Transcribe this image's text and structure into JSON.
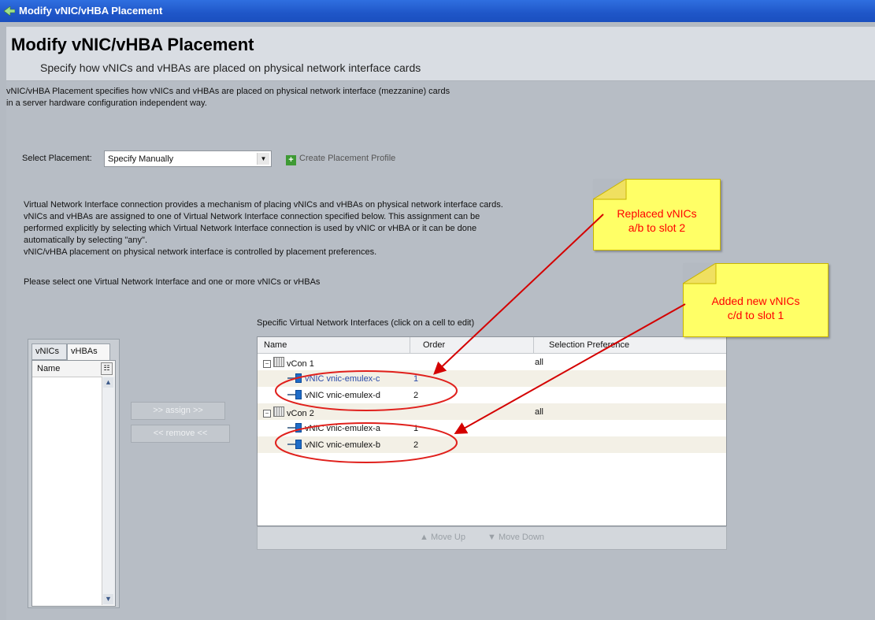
{
  "window": {
    "title": "Modify vNIC/vHBA Placement"
  },
  "header": {
    "title": "Modify vNIC/vHBA Placement",
    "subtitle": "Specify how vNICs and vHBAs are placed on physical network interface cards"
  },
  "description": {
    "line1": "vNIC/vHBA Placement specifies how vNICs and vHBAs are placed on physical network interface (mezzanine) cards",
    "line2": "in a server hardware configuration independent way."
  },
  "placement": {
    "label": "Select Placement:",
    "value": "Specify Manually",
    "create_label": "Create Placement Profile"
  },
  "vni_text": {
    "line1": "Virtual Network Interface connection provides a mechanism of placing vNICs and vHBAs on physical network interface cards.",
    "line2": "vNICs and vHBAs are assigned to one of Virtual Network Interface connection specified below. This assignment can be",
    "line3": "performed explicitly by selecting which Virtual Network Interface connection is used by vNIC or vHBA or it can be done",
    "line4": "automatically by selecting \"any\".",
    "line5": "vNIC/vHBA placement on physical network interface is controlled by placement preferences."
  },
  "please_text": "Please select one Virtual Network Interface and one or more vNICs or vHBAs",
  "left_panel": {
    "tabs": [
      "vNICs",
      "vHBAs"
    ],
    "column": "Name"
  },
  "buttons": {
    "assign": ">> assign >>",
    "remove": "<< remove <<"
  },
  "grid": {
    "title": "Specific Virtual Network Interfaces (click on a cell to edit)",
    "columns": [
      "Name",
      "Order",
      "Selection Preference"
    ],
    "rows": [
      {
        "name": "vCon 1",
        "order": "",
        "pref": "all"
      },
      {
        "name": "vNIC vnic-emulex-c",
        "order": "1",
        "pref": ""
      },
      {
        "name": "vNIC vnic-emulex-d",
        "order": "2",
        "pref": ""
      },
      {
        "name": "vCon 2",
        "order": "",
        "pref": "all"
      },
      {
        "name": "vNIC vnic-emulex-a",
        "order": "1",
        "pref": ""
      },
      {
        "name": "vNIC vnic-emulex-b",
        "order": "2",
        "pref": ""
      }
    ],
    "move_up": "Move Up",
    "move_down": "Move Down"
  },
  "notes": [
    {
      "line1": "Replaced vNICs",
      "line2": "a/b to slot 2"
    },
    {
      "line1": "Added new vNICs",
      "line2": "c/d to slot 1"
    }
  ],
  "colors": {
    "annotation": "#ff0000",
    "note_bg": "#ffff66",
    "title_bar": "#1f56c8"
  }
}
